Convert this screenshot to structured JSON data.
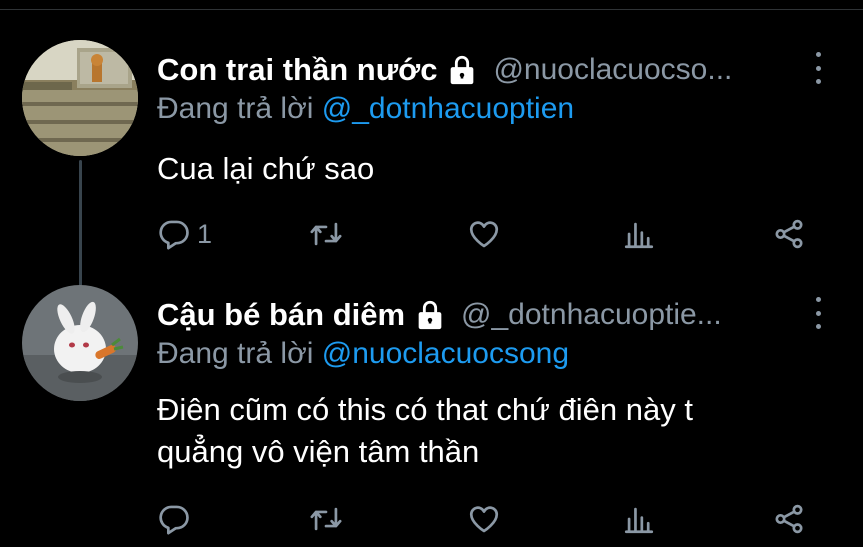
{
  "tweets": [
    {
      "name": "Con trai thần nước",
      "handle": "@nuoclacuocso...",
      "replying_prefix": "Đang trả lời ",
      "replying_to": "@_dotnhacuoptien",
      "lines": [
        "Cua lại chứ sao"
      ],
      "reply_count": "1",
      "avatar_icon": "window-sill-photo-avatar"
    },
    {
      "name": "Cậu bé bán diêm",
      "handle": "@_dotnhacuoptie...",
      "replying_prefix": "Đang trả lời ",
      "replying_to": "@nuoclacuocsong",
      "lines": [
        "Điên cũm có this có that chứ điên này t",
        "quẳng vô viện tâm thần"
      ],
      "reply_count": "",
      "avatar_icon": "white-rabbit-photo-avatar"
    }
  ],
  "icons": [
    "lock-icon",
    "more-vertical-icon",
    "reply-icon",
    "retweet-icon",
    "like-icon",
    "analytics-icon",
    "share-icon"
  ],
  "colors": {
    "background": "#000000",
    "text": "#ffffff",
    "muted": "#8b98a5",
    "link": "#1d9bf0",
    "thread_line": "#38444d"
  }
}
